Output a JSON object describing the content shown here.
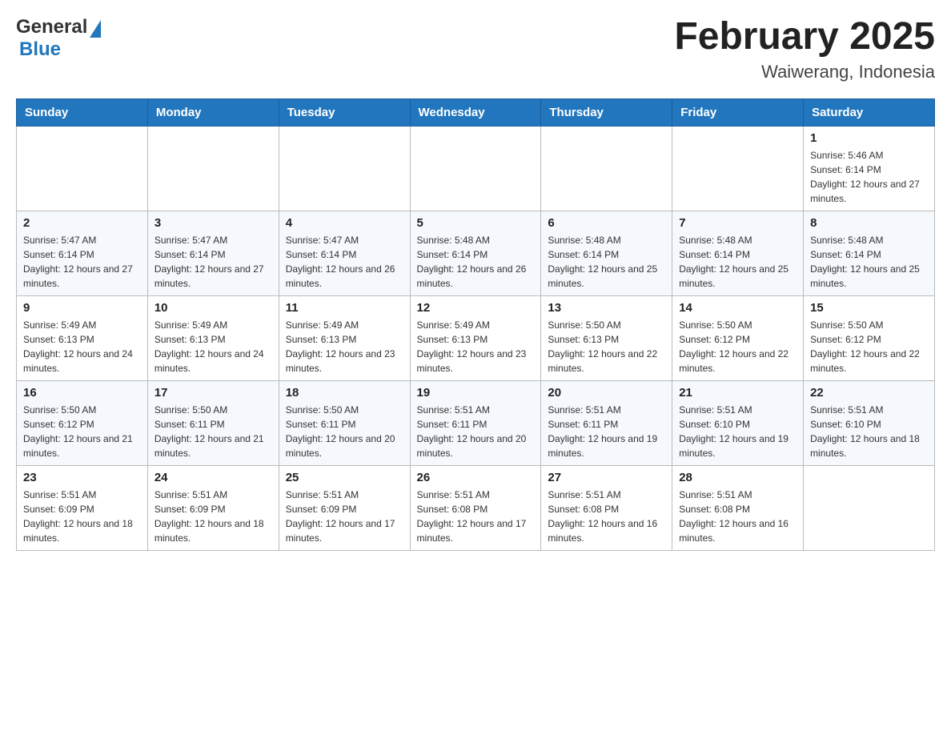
{
  "header": {
    "logo": {
      "general": "General",
      "blue": "Blue"
    },
    "title": "February 2025",
    "location": "Waiwerang, Indonesia"
  },
  "calendar": {
    "days_of_week": [
      "Sunday",
      "Monday",
      "Tuesday",
      "Wednesday",
      "Thursday",
      "Friday",
      "Saturday"
    ],
    "weeks": [
      [
        {
          "day": "",
          "info": ""
        },
        {
          "day": "",
          "info": ""
        },
        {
          "day": "",
          "info": ""
        },
        {
          "day": "",
          "info": ""
        },
        {
          "day": "",
          "info": ""
        },
        {
          "day": "",
          "info": ""
        },
        {
          "day": "1",
          "info": "Sunrise: 5:46 AM\nSunset: 6:14 PM\nDaylight: 12 hours and 27 minutes."
        }
      ],
      [
        {
          "day": "2",
          "info": "Sunrise: 5:47 AM\nSunset: 6:14 PM\nDaylight: 12 hours and 27 minutes."
        },
        {
          "day": "3",
          "info": "Sunrise: 5:47 AM\nSunset: 6:14 PM\nDaylight: 12 hours and 27 minutes."
        },
        {
          "day": "4",
          "info": "Sunrise: 5:47 AM\nSunset: 6:14 PM\nDaylight: 12 hours and 26 minutes."
        },
        {
          "day": "5",
          "info": "Sunrise: 5:48 AM\nSunset: 6:14 PM\nDaylight: 12 hours and 26 minutes."
        },
        {
          "day": "6",
          "info": "Sunrise: 5:48 AM\nSunset: 6:14 PM\nDaylight: 12 hours and 25 minutes."
        },
        {
          "day": "7",
          "info": "Sunrise: 5:48 AM\nSunset: 6:14 PM\nDaylight: 12 hours and 25 minutes."
        },
        {
          "day": "8",
          "info": "Sunrise: 5:48 AM\nSunset: 6:14 PM\nDaylight: 12 hours and 25 minutes."
        }
      ],
      [
        {
          "day": "9",
          "info": "Sunrise: 5:49 AM\nSunset: 6:13 PM\nDaylight: 12 hours and 24 minutes."
        },
        {
          "day": "10",
          "info": "Sunrise: 5:49 AM\nSunset: 6:13 PM\nDaylight: 12 hours and 24 minutes."
        },
        {
          "day": "11",
          "info": "Sunrise: 5:49 AM\nSunset: 6:13 PM\nDaylight: 12 hours and 23 minutes."
        },
        {
          "day": "12",
          "info": "Sunrise: 5:49 AM\nSunset: 6:13 PM\nDaylight: 12 hours and 23 minutes."
        },
        {
          "day": "13",
          "info": "Sunrise: 5:50 AM\nSunset: 6:13 PM\nDaylight: 12 hours and 22 minutes."
        },
        {
          "day": "14",
          "info": "Sunrise: 5:50 AM\nSunset: 6:12 PM\nDaylight: 12 hours and 22 minutes."
        },
        {
          "day": "15",
          "info": "Sunrise: 5:50 AM\nSunset: 6:12 PM\nDaylight: 12 hours and 22 minutes."
        }
      ],
      [
        {
          "day": "16",
          "info": "Sunrise: 5:50 AM\nSunset: 6:12 PM\nDaylight: 12 hours and 21 minutes."
        },
        {
          "day": "17",
          "info": "Sunrise: 5:50 AM\nSunset: 6:11 PM\nDaylight: 12 hours and 21 minutes."
        },
        {
          "day": "18",
          "info": "Sunrise: 5:50 AM\nSunset: 6:11 PM\nDaylight: 12 hours and 20 minutes."
        },
        {
          "day": "19",
          "info": "Sunrise: 5:51 AM\nSunset: 6:11 PM\nDaylight: 12 hours and 20 minutes."
        },
        {
          "day": "20",
          "info": "Sunrise: 5:51 AM\nSunset: 6:11 PM\nDaylight: 12 hours and 19 minutes."
        },
        {
          "day": "21",
          "info": "Sunrise: 5:51 AM\nSunset: 6:10 PM\nDaylight: 12 hours and 19 minutes."
        },
        {
          "day": "22",
          "info": "Sunrise: 5:51 AM\nSunset: 6:10 PM\nDaylight: 12 hours and 18 minutes."
        }
      ],
      [
        {
          "day": "23",
          "info": "Sunrise: 5:51 AM\nSunset: 6:09 PM\nDaylight: 12 hours and 18 minutes."
        },
        {
          "day": "24",
          "info": "Sunrise: 5:51 AM\nSunset: 6:09 PM\nDaylight: 12 hours and 18 minutes."
        },
        {
          "day": "25",
          "info": "Sunrise: 5:51 AM\nSunset: 6:09 PM\nDaylight: 12 hours and 17 minutes."
        },
        {
          "day": "26",
          "info": "Sunrise: 5:51 AM\nSunset: 6:08 PM\nDaylight: 12 hours and 17 minutes."
        },
        {
          "day": "27",
          "info": "Sunrise: 5:51 AM\nSunset: 6:08 PM\nDaylight: 12 hours and 16 minutes."
        },
        {
          "day": "28",
          "info": "Sunrise: 5:51 AM\nSunset: 6:08 PM\nDaylight: 12 hours and 16 minutes."
        },
        {
          "day": "",
          "info": ""
        }
      ]
    ]
  }
}
